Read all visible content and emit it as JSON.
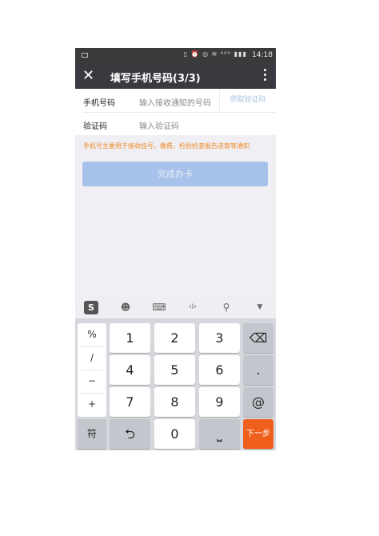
{
  "status_bar": {
    "time": "14:18",
    "icons": "▯ ⏰ ◎ ≋ ⁴⁶ᴳ ▮▮▮"
  },
  "header": {
    "close_icon": "✕",
    "title": "填写手机号码(3/3)"
  },
  "form": {
    "phone": {
      "label": "手机号码",
      "placeholder": "输入接收通知的号码",
      "code_button": "获取验证码"
    },
    "code": {
      "label": "验证码",
      "placeholder": "输入验证码"
    }
  },
  "notice": "手机号主要用于接收挂号，缴费，检验检查报告进度等通知",
  "submit_label": "完成办卡",
  "keyboard": {
    "toolbar": {
      "logo": "S",
      "emoji": "☻",
      "keyboard": "⌨",
      "cursor": "‹I›",
      "search": "⚲",
      "collapse": "▼"
    },
    "symbols": [
      "%",
      "/",
      "−",
      "+"
    ],
    "digits": [
      "1",
      "2",
      "3",
      "4",
      "5",
      "6",
      "7",
      "8",
      "9",
      "0"
    ],
    "backspace": "⌫",
    "dot": ".",
    "at": "@",
    "sym_key": "符",
    "return_key": "⮌",
    "space_key": "⎵",
    "next_key": "下一步"
  },
  "colors": {
    "accent": "#f05e1c",
    "submit_disabled": "#a6c2ea",
    "notice": "#f08a24",
    "titlebar": "#393a3f"
  }
}
